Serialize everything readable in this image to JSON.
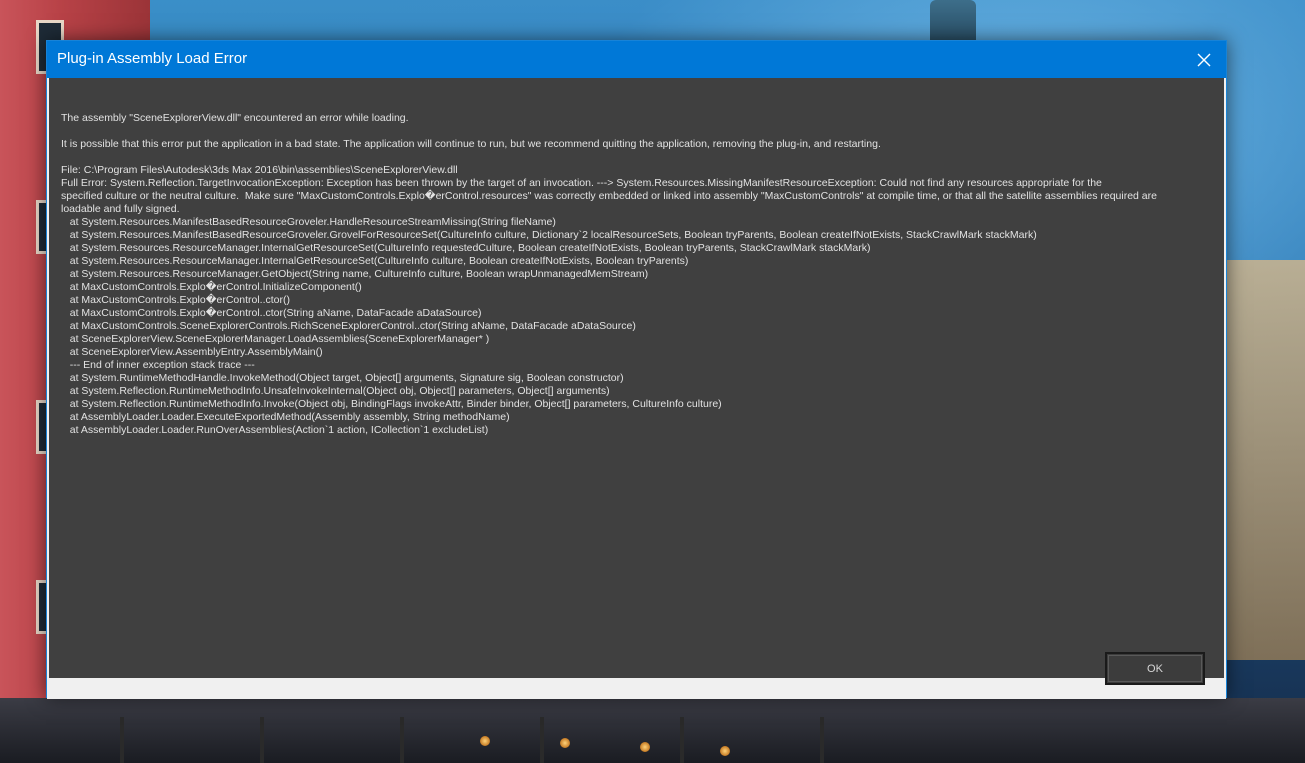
{
  "dialog": {
    "title": "Plug-in Assembly Load Error",
    "ok_label": "OK"
  },
  "message": {
    "line1": "The assembly \"SceneExplorerView.dll\" encountered an error while loading.",
    "line2": "It is possible that this error put the application in a bad state. The application will continue to run, but we recommend quitting the application, removing the plug-in, and restarting.",
    "file": "File: C:\\Program Files\\Autodesk\\3ds Max 2016\\bin\\assemblies\\SceneExplorerView.dll",
    "error_lines": [
      "Full Error: System.Reflection.TargetInvocationException: Exception has been thrown by the target of an invocation. ---> System.Resources.MissingManifestResourceException: Could not find any resources appropriate for the",
      "specified culture or the neutral culture.  Make sure \"MaxCustomControls.Explo�erControl.resources\" was correctly embedded or linked into assembly \"MaxCustomControls\" at compile time, or that all the satellite assemblies required are",
      "loadable and fully signed.",
      "   at System.Resources.ManifestBasedResourceGroveler.HandleResourceStreamMissing(String fileName)",
      "   at System.Resources.ManifestBasedResourceGroveler.GrovelForResourceSet(CultureInfo culture, Dictionary`2 localResourceSets, Boolean tryParents, Boolean createIfNotExists, StackCrawlMark stackMark)",
      "   at System.Resources.ResourceManager.InternalGetResourceSet(CultureInfo requestedCulture, Boolean createIfNotExists, Boolean tryParents, StackCrawlMark stackMark)",
      "   at System.Resources.ResourceManager.InternalGetResourceSet(CultureInfo culture, Boolean createIfNotExists, Boolean tryParents)",
      "   at System.Resources.ResourceManager.GetObject(String name, CultureInfo culture, Boolean wrapUnmanagedMemStream)",
      "   at MaxCustomControls.Explo�erControl.InitializeComponent()",
      "   at MaxCustomControls.Explo�erControl..ctor()",
      "   at MaxCustomControls.Explo�erControl..ctor(String aName, DataFacade aDataSource)",
      "   at MaxCustomControls.SceneExplorerControls.RichSceneExplorerControl..ctor(String aName, DataFacade aDataSource)",
      "   at SceneExplorerView.SceneExplorerManager.LoadAssemblies(SceneExplorerManager* )",
      "   at SceneExplorerView.AssemblyEntry.AssemblyMain()",
      "   --- End of inner exception stack trace ---",
      "   at System.RuntimeMethodHandle.InvokeMethod(Object target, Object[] arguments, Signature sig, Boolean constructor)",
      "   at System.Reflection.RuntimeMethodInfo.UnsafeInvokeInternal(Object obj, Object[] parameters, Object[] arguments)",
      "   at System.Reflection.RuntimeMethodInfo.Invoke(Object obj, BindingFlags invokeAttr, Binder binder, Object[] parameters, CultureInfo culture)",
      "   at AssemblyLoader.Loader.ExecuteExportedMethod(Assembly assembly, String methodName)",
      "   at AssemblyLoader.Loader.RunOverAssemblies(Action`1 action, ICollection`1 excludeList)"
    ]
  },
  "colors": {
    "titlebar": "#0078d7",
    "content_bg": "#404040",
    "content_text": "#e2e2e2",
    "footer_bg": "#f0f0f0"
  },
  "icons": {
    "close": "close-icon"
  }
}
